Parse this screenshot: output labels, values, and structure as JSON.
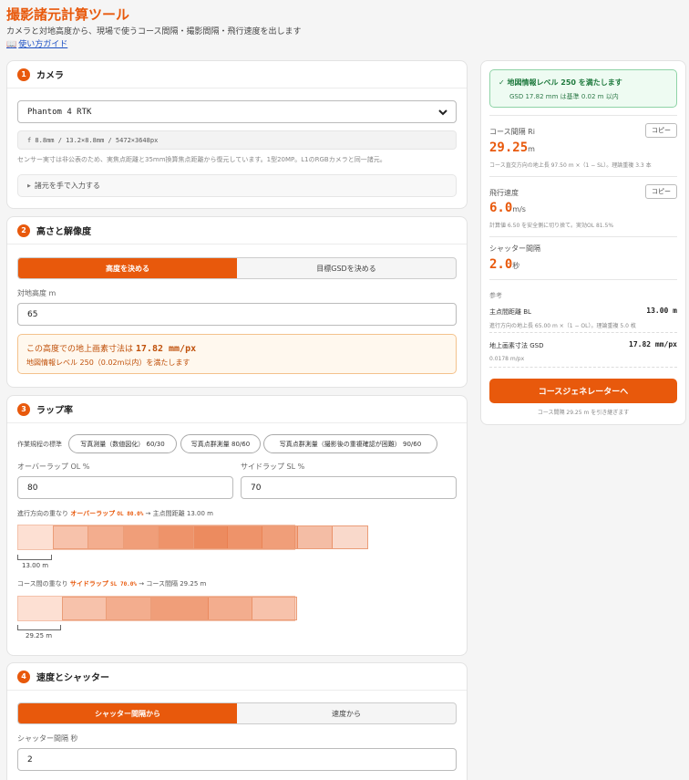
{
  "header": {
    "title": "撮影諸元計算ツール",
    "subtitle": "カメラと対地高度から、現場で使うコース間隔・撮影間隔・飛行速度を出します",
    "guide_icon": "📖",
    "guide_link": "使い方ガイド"
  },
  "camera": {
    "number": "1",
    "title": "カメラ",
    "selected": "Phantom 4 RTK",
    "spec": "f 8.8mm / 13.2×8.8mm / 5472×3648px",
    "note": "センサー実寸は非公表のため、実焦点距離と35mm換算焦点距離から復元しています。1型20MP。L1のRGBカメラと同一諸元。",
    "manual_toggle": "諸元を手で入力する"
  },
  "height": {
    "number": "2",
    "title": "高さと解像度",
    "tabs": [
      "高度を決める",
      "目標GSDを決める"
    ],
    "altitude_label": "対地高度 m",
    "altitude_value": "65",
    "gsd_prefix": "この高度での地上画素寸法は",
    "gsd_value": "17.82 mm/px",
    "gsd_level": "地図情報レベル 250（0.02m以内）を満たします"
  },
  "lap": {
    "number": "3",
    "title": "ラップ率",
    "standards_label": "作業規程の標準",
    "presets": [
      "写真測量（数値図化） 60/30",
      "写真点群測量 80/60",
      "写真点群測量（撮影後の重複確認が困難） 90/60"
    ],
    "ol_label": "オーバーラップ OL %",
    "ol_value": "80",
    "sl_label": "サイドラップ SL %",
    "sl_value": "70",
    "forward": {
      "prefix": "進行方向の重なり",
      "name": "オーバーラップ",
      "code": "OL 80.0%",
      "suffix": "→ 主点間距離 13.00 m",
      "scale_label": "13.00 m",
      "overlap_pct": 80
    },
    "side": {
      "prefix": "コース間の重なり",
      "name": "サイドラップ",
      "code": "SL 70.0%",
      "suffix": "→ コース間隔 29.25 m",
      "scale_label": "29.25 m",
      "overlap_pct": 70
    }
  },
  "speed": {
    "number": "4",
    "title": "速度とシャッター",
    "tabs": [
      "シャッター間隔から",
      "速度から"
    ],
    "shutter_label": "シャッター間隔 秒",
    "shutter_value": "2"
  },
  "results": {
    "ok_title": "地図情報レベル 250 を満たします",
    "ok_sub": "GSD 17.82 mm は基準 0.02 m 以内",
    "course": {
      "label": "コース間隔 Ri",
      "value": "29.25",
      "unit": "m",
      "note": "コース直交方向の地上長 97.50 m ×（1 − SL）。理論重複 3.3 本",
      "copy": "コピー"
    },
    "flight": {
      "label": "飛行速度",
      "value": "6.0",
      "unit": "m/s",
      "note": "計算値 6.50 を安全側に切り捨て。実効OL 81.5%",
      "copy": "コピー"
    },
    "shutter": {
      "label": "シャッター間隔",
      "value": "2.0",
      "unit": "秒"
    },
    "ref_label": "参考",
    "baseline": {
      "label": "主点間距離 BL",
      "value": "13.00 m",
      "note": "進行方向の地上長 65.00 m ×（1 − OL）。理論重複 5.0 枚"
    },
    "gsd": {
      "label": "地上画素寸法 GSD",
      "value": "17.82 mm/px",
      "note": "0.0178 m/px"
    },
    "cta": "コースジェネレーターへ",
    "cta_note": "コース間隔 29.25 m を引き継ぎます"
  }
}
